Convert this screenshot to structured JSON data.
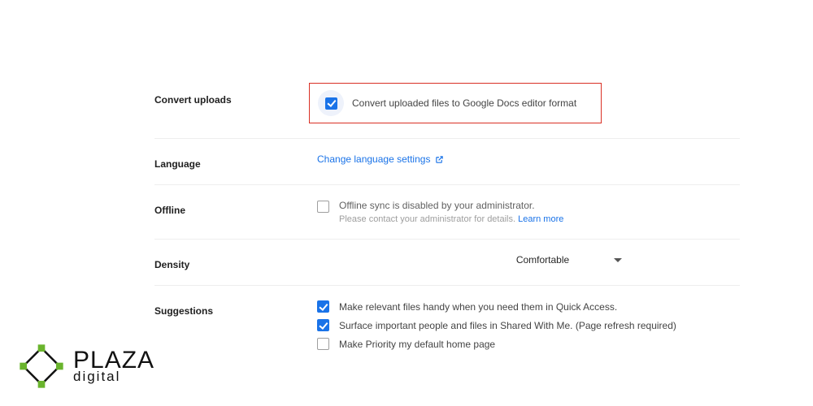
{
  "settings": {
    "convert": {
      "label": "Convert uploads",
      "option": "Convert uploaded files to Google Docs editor format",
      "checked": true
    },
    "language": {
      "label": "Language",
      "link": "Change language settings"
    },
    "offline": {
      "label": "Offline",
      "text": "Offline sync is disabled by your administrator.",
      "sub": "Please contact your administrator for details. ",
      "learn_more": "Learn more",
      "checked": false
    },
    "density": {
      "label": "Density",
      "value": "Comfortable"
    },
    "suggestions": {
      "label": "Suggestions",
      "items": [
        {
          "text": "Make relevant files handy when you need them in Quick Access.",
          "checked": true
        },
        {
          "text": "Surface important people and files in Shared With Me. (Page refresh required)",
          "checked": true
        },
        {
          "text": "Make Priority my default home page",
          "checked": false
        }
      ]
    }
  },
  "logo": {
    "line1": "PLAZA",
    "line2": "digital"
  }
}
